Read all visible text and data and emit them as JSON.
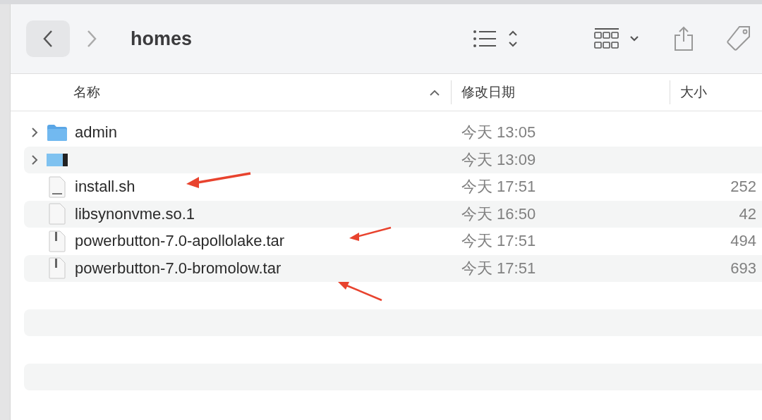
{
  "toolbar": {
    "title": "homes"
  },
  "columns": [
    {
      "label": "名称",
      "sorted": true
    },
    {
      "label": "修改日期",
      "sorted": false
    },
    {
      "label": "大小",
      "sorted": false
    }
  ],
  "rows": [
    {
      "kind": "folder",
      "name": "admin",
      "date": "今天 13:05",
      "size": "",
      "expandable": true
    },
    {
      "kind": "redacted",
      "name": "",
      "date": "今天 13:09",
      "size": "",
      "expandable": true
    },
    {
      "kind": "shell",
      "name": "install.sh",
      "date": "今天 17:51",
      "size": "252",
      "expandable": false
    },
    {
      "kind": "file",
      "name": "libsynonvme.so.1",
      "date": "今天 16:50",
      "size": "42",
      "expandable": false
    },
    {
      "kind": "archive",
      "name": "powerbutton-7.0-apollolake.tar",
      "date": "今天 17:51",
      "size": "494",
      "expandable": false
    },
    {
      "kind": "archive",
      "name": "powerbutton-7.0-bromolow.tar",
      "date": "今天 17:51",
      "size": "693",
      "expandable": false
    }
  ]
}
